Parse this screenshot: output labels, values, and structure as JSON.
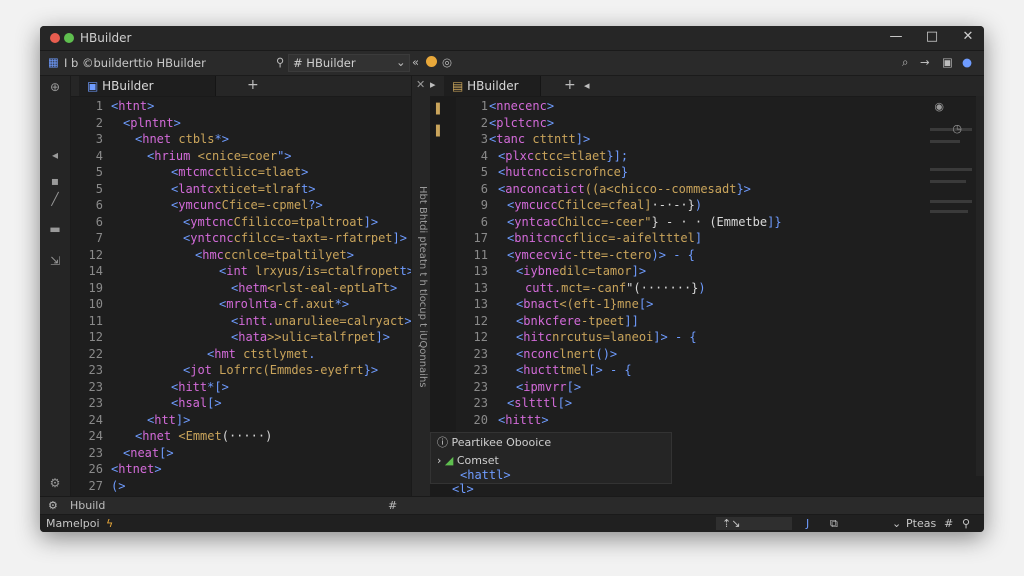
{
  "app": {
    "title": "HBuilder",
    "window_controls": [
      "—",
      "□",
      "✕"
    ],
    "colors": {
      "close_dot": "#e85d4f",
      "min_dot": "#5fbf4f",
      "accent": "#6f9cff",
      "tag": "#d36bd9",
      "attr": "#c9a45b"
    }
  },
  "toolbar": {
    "path_text": "I b ©builderttio HBuilder",
    "project_label": "HBuilder",
    "icons": [
      "document-icon",
      "pin-icon",
      "hash-icon",
      "chevron-down-icon",
      "back-icon",
      "orange-circle-icon",
      "globe-icon",
      "search-icon",
      "forward-icon",
      "save-icon",
      "user-icon"
    ]
  },
  "left_editor": {
    "tab_label": "HBuilder",
    "lines": [
      {
        "n": "1",
        "indent": 0,
        "parts": [
          [
            "br",
            "<"
          ],
          [
            "tag",
            "htnt"
          ],
          [
            "br",
            ">"
          ]
        ]
      },
      {
        "n": "2",
        "indent": 1,
        "parts": [
          [
            "br",
            "<"
          ],
          [
            "tag",
            "plntnt"
          ],
          [
            "br",
            ">"
          ]
        ]
      },
      {
        "n": "3",
        "indent": 2,
        "parts": [
          [
            "br",
            "<"
          ],
          [
            "tag",
            "hnet"
          ],
          [
            "val",
            " "
          ],
          [
            "attr",
            "ctbls"
          ],
          [
            "br",
            "*>"
          ]
        ]
      },
      {
        "n": "4",
        "indent": 3,
        "parts": [
          [
            "br",
            "<"
          ],
          [
            "tag",
            "hrium"
          ],
          [
            "val",
            " "
          ],
          [
            "attr",
            "<cnice=coer"
          ],
          [
            "br",
            "\">"
          ]
        ]
      },
      {
        "n": "5",
        "indent": 5,
        "parts": [
          [
            "br",
            "<"
          ],
          [
            "tag",
            "mtcmc"
          ],
          [
            "attr",
            "ctlicc=tlaet"
          ],
          [
            "br",
            ">"
          ]
        ]
      },
      {
        "n": "5",
        "indent": 5,
        "parts": [
          [
            "br",
            "<"
          ],
          [
            "tag",
            "lantc"
          ],
          [
            "attr",
            "xticet=tlraf"
          ],
          [
            "br",
            "t>"
          ]
        ]
      },
      {
        "n": "6",
        "indent": 5,
        "parts": [
          [
            "br",
            "<"
          ],
          [
            "tag",
            "ymcunc"
          ],
          [
            "attr",
            "Cfice=-cpmel"
          ],
          [
            "br",
            "?>"
          ]
        ]
      },
      {
        "n": "6",
        "indent": 6,
        "parts": [
          [
            "br",
            "<"
          ],
          [
            "tag",
            "ymtcnc"
          ],
          [
            "attr",
            "Cfilicco=tpaltroat"
          ],
          [
            "br",
            "]>"
          ]
        ]
      },
      {
        "n": "7",
        "indent": 6,
        "parts": [
          [
            "br",
            "<"
          ],
          [
            "tag",
            "yntcnc"
          ],
          [
            "attr",
            "cfilcc=-taxt=-rfatrpet"
          ],
          [
            "br",
            "]>"
          ]
        ]
      },
      {
        "n": "12",
        "indent": 7,
        "parts": [
          [
            "br",
            "<"
          ],
          [
            "tag",
            "hmc"
          ],
          [
            "attr",
            "ccnlce=tpaltilyet"
          ],
          [
            "br",
            ">"
          ]
        ]
      },
      {
        "n": "14",
        "indent": 9,
        "parts": [
          [
            "br",
            "<"
          ],
          [
            "tag",
            "int"
          ],
          [
            "val",
            " "
          ],
          [
            "attr",
            "lrxyus/is=ctalfropet"
          ],
          [
            "br",
            "t>"
          ]
        ]
      },
      {
        "n": "19",
        "indent": 10,
        "parts": [
          [
            "br",
            "<"
          ],
          [
            "tag",
            "hetm"
          ],
          [
            "attr",
            "<rlst-eal-eptLaTt"
          ],
          [
            "br",
            ">"
          ]
        ]
      },
      {
        "n": "10",
        "indent": 9,
        "parts": [
          [
            "br",
            "<"
          ],
          [
            "tag",
            "mrolnta"
          ],
          [
            "attr",
            "-cf.axut"
          ],
          [
            "br",
            "*>"
          ]
        ]
      },
      {
        "n": "11",
        "indent": 10,
        "parts": [
          [
            "br",
            "<"
          ],
          [
            "tag",
            "intt."
          ],
          [
            "attr",
            "unaruliee=calryact"
          ],
          [
            "br",
            ">"
          ]
        ]
      },
      {
        "n": "12",
        "indent": 10,
        "parts": [
          [
            "br",
            "<"
          ],
          [
            "tag",
            "hata"
          ],
          [
            "attr",
            ">>ulic=talfrpet"
          ],
          [
            "br",
            "]>"
          ]
        ]
      },
      {
        "n": "22",
        "indent": 8,
        "parts": [
          [
            "br",
            "<"
          ],
          [
            "tag",
            "hmt"
          ],
          [
            "val",
            " "
          ],
          [
            "attr",
            "ctstlymet"
          ],
          [
            "br",
            "."
          ]
        ]
      },
      {
        "n": "23",
        "indent": 6,
        "parts": [
          [
            "br",
            "<"
          ],
          [
            "tag",
            "jot"
          ],
          [
            "val",
            " "
          ],
          [
            "attr",
            "Lofrrc(Emmdes-eyefrt"
          ],
          [
            "br",
            "}>"
          ]
        ]
      },
      {
        "n": "23",
        "indent": 5,
        "parts": [
          [
            "br",
            "<"
          ],
          [
            "tag",
            "hitt"
          ],
          [
            "br",
            "*[>"
          ]
        ]
      },
      {
        "n": "23",
        "indent": 5,
        "parts": [
          [
            "br",
            "<"
          ],
          [
            "tag",
            "hsal"
          ],
          [
            "br",
            "[>"
          ]
        ]
      },
      {
        "n": "24",
        "indent": 3,
        "parts": [
          [
            "br",
            "<"
          ],
          [
            "tag",
            "htt"
          ],
          [
            "br",
            "]>"
          ]
        ]
      },
      {
        "n": "24",
        "indent": 2,
        "parts": [
          [
            "br",
            "<"
          ],
          [
            "tag",
            "hnet"
          ],
          [
            "val",
            " "
          ],
          [
            "attr",
            "<Emmet"
          ],
          [
            "val",
            "(·····)"
          ]
        ]
      },
      {
        "n": "23",
        "indent": 1,
        "parts": [
          [
            "br",
            "<"
          ],
          [
            "tag",
            "neat"
          ],
          [
            "br",
            "[>"
          ]
        ]
      },
      {
        "n": "26",
        "indent": 0,
        "parts": [
          [
            "br",
            "<"
          ],
          [
            "tag",
            "htnet"
          ],
          [
            "br",
            ">"
          ]
        ]
      },
      {
        "n": "27",
        "indent": 0,
        "parts": [
          [
            "br",
            "(>"
          ]
        ]
      }
    ]
  },
  "right_editor": {
    "tab_label": "HBuilder",
    "lines": [
      {
        "n": "1",
        "indent": 1,
        "parts": [
          [
            "br",
            "<"
          ],
          [
            "tag",
            "nnecenc"
          ],
          [
            "br",
            ">"
          ]
        ]
      },
      {
        "n": "2",
        "indent": 1,
        "parts": [
          [
            "br",
            "<"
          ],
          [
            "tag",
            "plctcnc"
          ],
          [
            "br",
            ">"
          ]
        ]
      },
      {
        "n": "3",
        "indent": 1,
        "parts": [
          [
            "br",
            "<"
          ],
          [
            "tag",
            "tanc"
          ],
          [
            "val",
            " "
          ],
          [
            "attr",
            "cttntt"
          ],
          [
            "br",
            "]>"
          ]
        ]
      },
      {
        "n": "4",
        "indent": 2,
        "parts": [
          [
            "br",
            "<"
          ],
          [
            "tag",
            "plxc"
          ],
          [
            "attr",
            "ctcc=tlaet"
          ],
          [
            "br",
            "}];"
          ]
        ]
      },
      {
        "n": "5",
        "indent": 2,
        "parts": [
          [
            "br",
            "<"
          ],
          [
            "tag",
            "hutcnc"
          ],
          [
            "attr",
            "ciscrofnce"
          ],
          [
            "br",
            "}"
          ]
        ]
      },
      {
        "n": "6",
        "indent": 2,
        "parts": [
          [
            "br",
            "<"
          ],
          [
            "tag",
            "anconcatict"
          ],
          [
            "attr",
            "((a<chicco--commesadt"
          ],
          [
            "br",
            "}>"
          ]
        ]
      },
      {
        "n": "9",
        "indent": 3,
        "parts": [
          [
            "br",
            "<"
          ],
          [
            "tag",
            "ymcucc"
          ],
          [
            "attr",
            "Cfilce=cfeal]"
          ],
          [
            "val",
            "·-·-·}"
          ],
          [
            "br",
            ")"
          ]
        ]
      },
      {
        "n": "6",
        "indent": 3,
        "parts": [
          [
            "br",
            "<"
          ],
          [
            "tag",
            "yntcac"
          ],
          [
            "attr",
            "Chilcc=-ceer\""
          ],
          [
            "val",
            "} - · · (Emmetbe"
          ],
          [
            "br",
            "]}"
          ]
        ]
      },
      {
        "n": "17",
        "indent": 3,
        "parts": [
          [
            "br",
            "<"
          ],
          [
            "tag",
            "bnitcnc"
          ],
          [
            "attr",
            "cflicc=-aifeltttel"
          ],
          [
            "br",
            "]"
          ]
        ]
      },
      {
        "n": "11",
        "indent": 3,
        "parts": [
          [
            "br",
            "<"
          ],
          [
            "tag",
            "ymcecvic"
          ],
          [
            "attr",
            "-tte=-ctero"
          ],
          [
            "br",
            ")> - {"
          ]
        ]
      },
      {
        "n": "13",
        "indent": 4,
        "parts": [
          [
            "br",
            "<"
          ],
          [
            "tag",
            "iybne"
          ],
          [
            "attr",
            "dilc=tamor"
          ],
          [
            "br",
            "]>"
          ]
        ]
      },
      {
        "n": "13",
        "indent": 5,
        "parts": [
          [
            "br",
            ""
          ],
          [
            "tag",
            "cutt."
          ],
          [
            "attr",
            "mct=-canf"
          ],
          [
            "val",
            "\"(·······}"
          ],
          [
            "br",
            ")"
          ]
        ]
      },
      {
        "n": "13",
        "indent": 4,
        "parts": [
          [
            "br",
            "<"
          ],
          [
            "tag",
            "bnact"
          ],
          [
            "attr",
            "<(eft-1}mne"
          ],
          [
            "br",
            "[>"
          ]
        ]
      },
      {
        "n": "12",
        "indent": 4,
        "parts": [
          [
            "br",
            "<"
          ],
          [
            "tag",
            "bnkcfere"
          ],
          [
            "attr",
            "-tpeet"
          ],
          [
            "br",
            "]]"
          ]
        ]
      },
      {
        "n": "12",
        "indent": 4,
        "parts": [
          [
            "br",
            "<"
          ],
          [
            "tag",
            "hitc"
          ],
          [
            "attr",
            "nrcutus=laneoi"
          ],
          [
            "br",
            "]> - {"
          ]
        ]
      },
      {
        "n": "23",
        "indent": 4,
        "parts": [
          [
            "br",
            "<"
          ],
          [
            "tag",
            "nconc"
          ],
          [
            "attr",
            "lnert"
          ],
          [
            "br",
            "()>"
          ]
        ]
      },
      {
        "n": "23",
        "indent": 4,
        "parts": [
          [
            "br",
            "<"
          ],
          [
            "tag",
            "huctt"
          ],
          [
            "attr",
            "tmel"
          ],
          [
            "br",
            "[> - {"
          ]
        ]
      },
      {
        "n": "23",
        "indent": 4,
        "parts": [
          [
            "br",
            "<"
          ],
          [
            "tag",
            "ipmvrr"
          ],
          [
            "br",
            "[>"
          ]
        ]
      },
      {
        "n": "23",
        "indent": 3,
        "parts": [
          [
            "br",
            "<"
          ],
          [
            "tag",
            "sltttl"
          ],
          [
            "br",
            "[>"
          ]
        ]
      },
      {
        "n": "20",
        "indent": 2,
        "parts": [
          [
            "br",
            "<"
          ],
          [
            "tag",
            "hittt"
          ],
          [
            "br",
            ">"
          ]
        ]
      }
    ],
    "popup": {
      "header": "Peartikee  Obooice",
      "item": "Comset",
      "sub1": "<hattl>",
      "sub2": "<l>",
      "sub3": "[>"
    }
  },
  "splitter_text": "Hbt Bhtdi pteatn t h tlocup t  iUQonnaihs",
  "statusbar": {
    "left_label": "Hbuild",
    "right_items": [
      "Pteas",
      "#"
    ]
  },
  "bottombar": {
    "left_label": "Mamelpoi"
  }
}
